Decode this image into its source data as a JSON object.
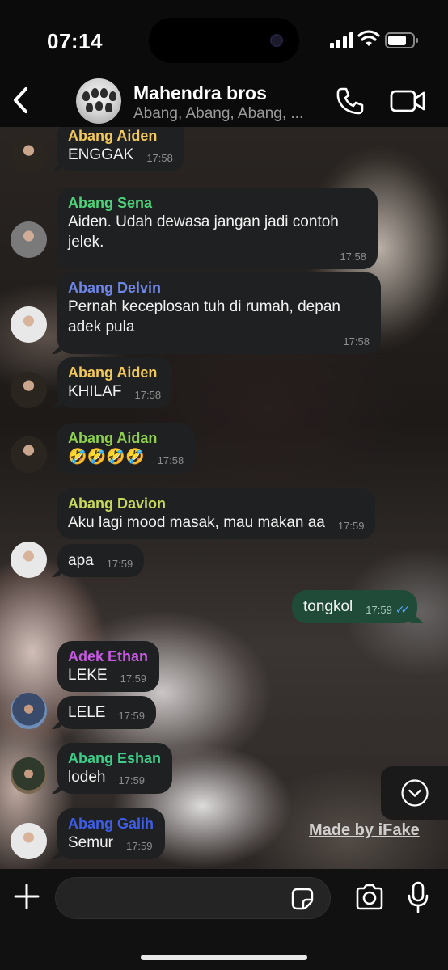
{
  "status_bar": {
    "time": "07:14"
  },
  "header": {
    "title": "Mahendra bros",
    "members": "Abang, Abang, Abang, ..."
  },
  "colors": {
    "incoming_bubble": "#1f2021",
    "outgoing_bubble": "#1f4b38",
    "read_ticks": "#4fa6ff"
  },
  "messages": [
    {
      "sender": "Abang Aiden",
      "sender_color": "#f2c85b",
      "text": "ENGGAK",
      "time": "17:58"
    },
    {
      "sender": "Abang Sena",
      "sender_color": "#4ed27a",
      "text": "Aiden. Udah dewasa jangan jadi contoh jelek.",
      "time": "17:58"
    },
    {
      "sender": "Abang Delvin",
      "sender_color": "#6f86e8",
      "text": "Pernah keceplosan tuh di rumah, depan adek pula",
      "time": "17:58"
    },
    {
      "sender": "Abang Aiden",
      "sender_color": "#f2c85b",
      "text": "KHILAF",
      "time": "17:58"
    },
    {
      "sender": "Abang Aidan",
      "sender_color": "#8fd14f",
      "text": "🤣🤣🤣🤣",
      "time": "17:58"
    },
    {
      "sender": "Abang Davion",
      "sender_color": "#c7d85a",
      "text": "Aku lagi mood masak, mau makan aa",
      "time": "17:59"
    },
    {
      "sender": "",
      "text": "apa",
      "time": "17:59"
    },
    {
      "outgoing": true,
      "text": "tongkol",
      "time": "17:59"
    },
    {
      "sender": "Adek Ethan",
      "sender_color": "#c65ae0",
      "text": "LEKE",
      "time": "17:59"
    },
    {
      "sender": "",
      "text": "LELE",
      "time": "17:59"
    },
    {
      "sender": "Abang Eshan",
      "sender_color": "#3fce8a",
      "text": "lodeh",
      "time": "17:59"
    },
    {
      "sender": "Abang Galih",
      "sender_color": "#3e5ee8",
      "text": "Semur",
      "time": "17:59"
    }
  ],
  "watermark": "Made by iFake",
  "icons": [
    "back-chevron-icon",
    "phone-icon",
    "video-camera-icon",
    "chevron-down-icon",
    "plus-icon",
    "sticker-icon",
    "camera-icon",
    "microphone-icon"
  ]
}
